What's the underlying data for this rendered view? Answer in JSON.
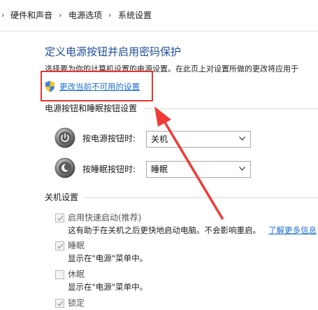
{
  "breadcrumb": {
    "items": [
      "硬件和声音",
      "电源选项",
      "系统设置"
    ],
    "separator": "›"
  },
  "page": {
    "title": "定义电源按钮并启用密码保护",
    "description": "选择要为你的计算机设置的电源设置。在此页上对设置所做的更改将应用于",
    "change_link": "更改当前不可用的设置"
  },
  "power_buttons": {
    "group_title": "电源按钮和睡眠按钮设置",
    "power_button_label": "按电源按钮时:",
    "power_button_value": "关机",
    "sleep_button_label": "按睡眠按钮时:",
    "sleep_button_value": "睡眠"
  },
  "shutdown": {
    "group_title": "关机设置",
    "options": [
      {
        "label": "启用快速启动(推荐)",
        "checked": true,
        "desc": "这有助于在关机之后更快地启动电脑。不会影响重启。",
        "link": "了解更多信息"
      },
      {
        "label": "睡眠",
        "checked": true,
        "desc": "显示在\"电源\"菜单中。"
      },
      {
        "label": "休眠",
        "checked": false,
        "desc": "显示在\"电源\"菜单中。"
      },
      {
        "label": "锁定",
        "checked": true
      }
    ]
  },
  "colors": {
    "highlight": "#e8332f",
    "link": "#1a6fd1",
    "title": "#1e4e9a"
  },
  "icons": {
    "shield": "uac-shield-icon",
    "power": "power-button-icon",
    "sleep": "sleep-button-icon"
  }
}
